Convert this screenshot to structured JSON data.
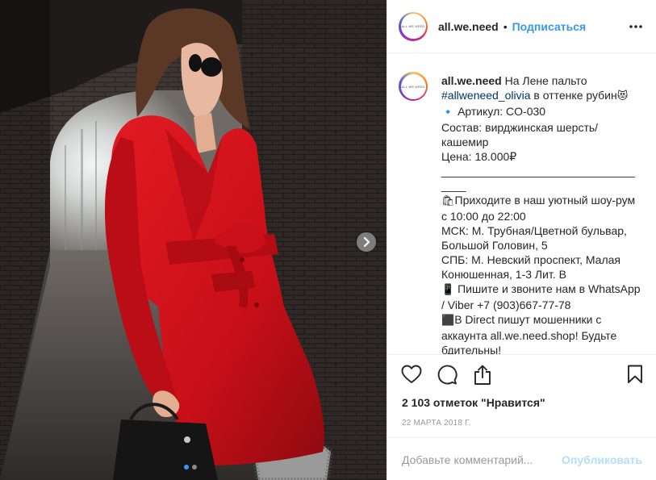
{
  "post": {
    "username": "all.we.need",
    "avatar_text": "ALL WE NEED",
    "header_dot": "•",
    "follow_label": "Подписаться",
    "caption_lines": [
      {
        "username": "all.we.need",
        "text": " На Лене пальто"
      },
      {
        "tag": "#allweneed_olivia",
        "text": " в оттенке рубин",
        "emoji": "😻"
      },
      {
        "emoji": "🔹",
        "text": " Артикул: CO-030"
      },
      {
        "text": "Состав: вирджинская шерсть/"
      },
      {
        "text": "кашемир"
      },
      {
        "text": "Цена: 18.000₽"
      },
      {
        "separator": "________________________________"
      },
      {
        "separator": "____"
      },
      {
        "emoji": "🛍",
        "text": "Приходите в наш уютный шоу-рум"
      },
      {
        "text": "с 10:00 до 22:00"
      },
      {
        "text": "МСК: М. Трубная/Цветной бульвар,"
      },
      {
        "text": "Большой Головин, 5"
      },
      {
        "text": "СПБ: М. Невский проспект, Малая"
      },
      {
        "text": "Конюшенная, 1-3 Лит. В"
      },
      {
        "emoji": "📱",
        "text": " Пишите и звоните нам в WhatsApp"
      },
      {
        "text": "/ Viber +7 (903)667-77-78"
      },
      {
        "emoji": "⬛",
        "text": "В Direct пишут мошенники с"
      },
      {
        "text": "аккаунта all.we.need.shop! Будьте"
      },
      {
        "text": "бдительны!"
      }
    ],
    "likes_text": "2 103 отметок \"Нравится\"",
    "date_text": "22 МАРТА 2018 Г.",
    "comment_placeholder": "Добавьте комментарий...",
    "publish_label": "Опубликовать",
    "carousel": {
      "current": 1,
      "total": 2
    }
  },
  "icons": {
    "like": "heart-icon",
    "comment": "comment-icon",
    "share": "share-icon",
    "save": "bookmark-icon",
    "more": "more-dots-icon",
    "next": "chevron-right-icon"
  },
  "colors": {
    "link": "#3897f0",
    "hashtag": "#003569",
    "publish_disabled": "#b2dffc",
    "coat": "#d8121b"
  }
}
